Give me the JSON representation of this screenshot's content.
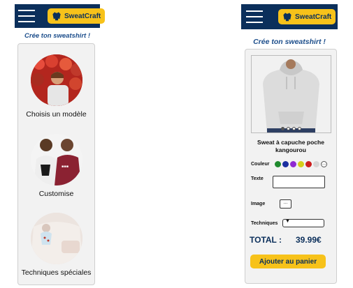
{
  "brand": {
    "name": "SweatCraft",
    "accent": "#f7c21a",
    "primary": "#0b2f5b"
  },
  "left": {
    "heading": "Crée ton sweatshirt !",
    "items": [
      {
        "label": "Choisis un modèle",
        "icon": "model-photo"
      },
      {
        "label": "Customise",
        "icon": "custom-photo"
      },
      {
        "label": "Techniques spéciales",
        "icon": "technique-photo"
      }
    ]
  },
  "right": {
    "heading": "Crée ton sweatshirt !",
    "product_name": "Sweat à capuche poche kangourou",
    "color_label": "Couleur",
    "colors": [
      "#1f8a2e",
      "#1a2fa0",
      "#8f2bd1",
      "#d4cf1a",
      "#cc1f1f",
      "#d6d6d6"
    ],
    "more_colors": "...",
    "text_label": "Texte",
    "text_value": "",
    "image_label": "Image",
    "image_button": "...",
    "techniques_label": "Techniques",
    "techniques_value": "",
    "total_label": "TOTAL :",
    "total_value": "39.99€",
    "cta": "Ajouter au panier"
  }
}
